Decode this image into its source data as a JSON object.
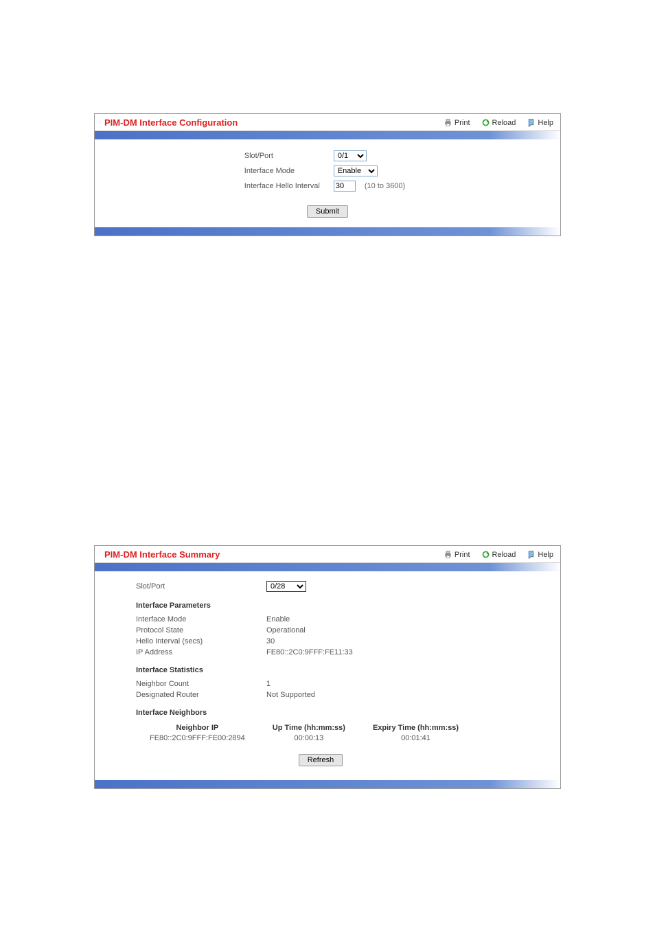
{
  "panel1": {
    "title": "PIM-DM Interface Configuration",
    "actions": {
      "print": "Print",
      "reload": "Reload",
      "help": "Help"
    },
    "form": {
      "slot_port_label": "Slot/Port",
      "slot_port_value": "0/1",
      "iface_mode_label": "Interface Mode",
      "iface_mode_value": "Enable",
      "hello_label": "Interface Hello Interval",
      "hello_value": "30",
      "hello_hint": "(10 to 3600)",
      "submit": "Submit"
    }
  },
  "panel2": {
    "title": "PIM-DM Interface Summary",
    "actions": {
      "print": "Print",
      "reload": "Reload",
      "help": "Help"
    },
    "slot_port_label": "Slot/Port",
    "slot_port_value": "0/28",
    "sections": {
      "params_title": "Interface Parameters",
      "params": {
        "iface_mode_label": "Interface Mode",
        "iface_mode_value": "Enable",
        "proto_state_label": "Protocol State",
        "proto_state_value": "Operational",
        "hello_interval_label": "Hello Interval (secs)",
        "hello_interval_value": "30",
        "ip_addr_label": "IP Address",
        "ip_addr_value": "FE80::2C0:9FFF:FE11:33"
      },
      "stats_title": "Interface Statistics",
      "stats": {
        "neighbor_count_label": "Neighbor Count",
        "neighbor_count_value": "1",
        "designated_router_label": "Designated Router",
        "designated_router_value": "Not Supported"
      },
      "neighbors_title": "Interface Neighbors",
      "neighbors": {
        "col_ip": "Neighbor IP",
        "col_up": "Up Time (hh:mm:ss)",
        "col_exp": "Expiry Time (hh:mm:ss)",
        "row": {
          "ip": "FE80::2C0:9FFF:FE00:2894",
          "up": "00:00:13",
          "exp": "00:01:41"
        }
      }
    },
    "refresh": "Refresh"
  }
}
